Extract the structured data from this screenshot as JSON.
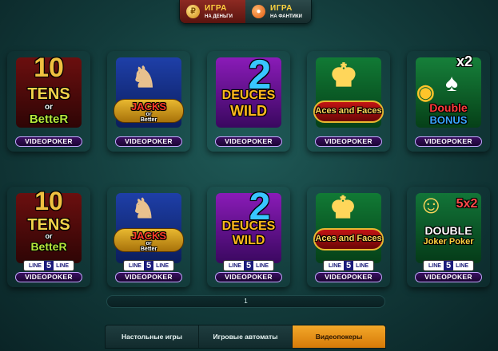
{
  "mode_switch": {
    "real": {
      "title": "ИГРА",
      "subtitle": "НА ДЕНЬГИ",
      "icon": "coin-icon"
    },
    "fun": {
      "title": "ИГРА",
      "subtitle": "НА ФАНТИКИ",
      "icon": "lollipop-icon"
    }
  },
  "games": [
    {
      "id": "tens-or-better",
      "l1": "10",
      "l2": "TENS",
      "l3": "or",
      "l4": "BetteR",
      "footer": "VIDEOPOKER"
    },
    {
      "id": "jacks-or-better",
      "l1": "JACKS",
      "l2": "or",
      "l3": "Better",
      "footer": "VIDEOPOKER"
    },
    {
      "id": "deuces-wild",
      "l1": "2",
      "l2": "DEUCES",
      "l3": "WILD",
      "footer": "VIDEOPOKER"
    },
    {
      "id": "aces-and-faces",
      "l1": "Aces and Faces",
      "footer": "VIDEOPOKER"
    },
    {
      "id": "double-bonus",
      "l1": "x2",
      "l2": "Double",
      "l3": "BONUS",
      "footer": "VIDEOPOKER"
    },
    {
      "id": "tens-or-better-5line",
      "l1": "10",
      "l2": "TENS",
      "l3": "or",
      "l4": "BetteR",
      "line_left": "LINE",
      "line_num": "5",
      "line_right": "LINE",
      "footer": "VIDEOPOKER"
    },
    {
      "id": "jacks-or-better-5line",
      "l1": "JACKS",
      "l2": "or",
      "l3": "Better",
      "line_left": "LINE",
      "line_num": "5",
      "line_right": "LINE",
      "footer": "VIDEOPOKER"
    },
    {
      "id": "deuces-wild-5line",
      "l1": "2",
      "l2": "DEUCES",
      "l3": "WILD",
      "line_left": "LINE",
      "line_num": "5",
      "line_right": "LINE",
      "footer": "VIDEOPOKER"
    },
    {
      "id": "aces-and-faces-5line",
      "l1": "Aces and Faces",
      "line_left": "LINE",
      "line_num": "5",
      "line_right": "LINE",
      "footer": "VIDEOPOKER"
    },
    {
      "id": "double-joker-poker-5line",
      "l1": "5x2",
      "l2": "DOUBLE",
      "l3": "Joker Poker",
      "line_left": "LINE",
      "line_num": "5",
      "line_right": "LINE",
      "footer": "VIDEOPOKER"
    }
  ],
  "pager": {
    "current": "1"
  },
  "tabs": [
    {
      "label": "Настольные игры",
      "active": false
    },
    {
      "label": "Игровые автоматы",
      "active": false
    },
    {
      "label": "Видеопокеры",
      "active": true
    }
  ],
  "colors": {
    "accent": "#f2a82a",
    "background": "#123a3a",
    "gold": "#ffd23f"
  }
}
